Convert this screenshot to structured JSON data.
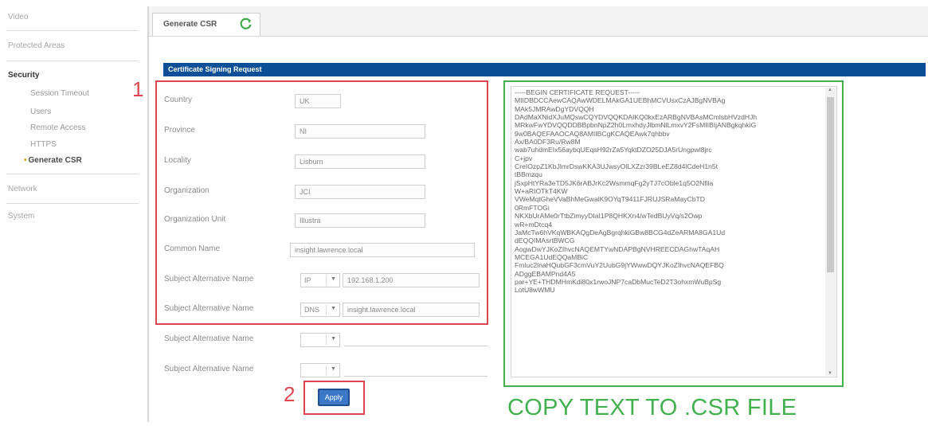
{
  "sidebar": {
    "items": [
      {
        "label": "Video"
      },
      {
        "label": "Protected Areas"
      },
      {
        "label": "Security"
      },
      {
        "label": "Session Timeout"
      },
      {
        "label": "Users"
      },
      {
        "label": "Remote Access"
      },
      {
        "label": "HTTPS"
      },
      {
        "label": "Generate CSR"
      },
      {
        "label": "Network"
      },
      {
        "label": "System"
      }
    ]
  },
  "tab": {
    "label": "Generate CSR",
    "icon": "refresh-icon"
  },
  "section": {
    "title": "Certificate Signing Request"
  },
  "form": {
    "country": {
      "label": "Country",
      "value": "UK"
    },
    "province": {
      "label": "Province",
      "value": "NI"
    },
    "locality": {
      "label": "Locality",
      "value": "Lisburn"
    },
    "organization": {
      "label": "Organization",
      "value": "JCI"
    },
    "org_unit": {
      "label": "Organization Unit",
      "value": "Illustra"
    },
    "common_name": {
      "label": "Common Name",
      "value": "insight.lawrence.local"
    },
    "san1": {
      "label": "Subject Alternative Name",
      "type": "IP",
      "value": "192.168.1.200"
    },
    "san2": {
      "label": "Subject Alternative Name",
      "type": "DNS",
      "value": "insight.lawrence.local"
    },
    "san3": {
      "label": "Subject Alternative Name",
      "type": "",
      "value": ""
    },
    "san4": {
      "label": "Subject Alternative Name",
      "type": "",
      "value": ""
    }
  },
  "apply_button": {
    "label": "Apply"
  },
  "annotations": {
    "step1": "1",
    "step2": "2",
    "copy_note": "COPY TEXT TO .CSR FILE"
  },
  "csr": {
    "text": "-----BEGIN CERTIFICATE REQUEST-----\nMIIDBDCCAewCAQAwWDELMAkGA1UEBhMCVUsxCzAJBgNVBAg\nMAk5JMRAwDgYDVQQH\nDAdMaXNidXJuMQswCQYDVQQKDAIKQ0kxEzARBgNVBAsMCmlsbHVzdHJh\nMRkwFwYDVQQDDBBpbnNpZ2h0LmxhdyJlbmNlLmxvY2FsMIIBIjANBgkqhkiG\n9w0BAQEFAAOCAQ8AMIIBCgKCAQEAwk7qhbbv\nAx/BA0DF3Ru/Rw8M\nwab7uhdmEIx56aybqUEqsH92rZa5YqktDZO25DJA5rUngpwl8jrc\nC+jpv\nCreIOzpZ1KbJlmrDswKKA3UJwsyOlLXZzr39BLeEZ8d4lCdeH1n5t\ntBBmzqu\njSxpHtYRa3eTD5JK6rABJrKc2WsmmqFg2yTJ7cOble1q5O2Nfila\nW+aRIOTkT4KW\nVWeMqtGheVVaBhMeGwalK9OYqT9411FJRUJSRaMayCbTD\n0RmFTOGi\nNKXbUrAMe0rTtbZimyyDIaI1P8QHKXn4/wTedBUyVq/s2Owp\nwR+mDtcq4\nJaMcTw6hVKqWBKAQgDeAgBgrqhkiGBw8BCG4dZeARMA8GA1Ud\ndEQQIMAsrtBWCG\nAogwDwYJKoZIhvcNAQEMTYwNDAPBgNVHREECDAGhwTAqAH\nMCEGA1UdEQQaMBiC\nFmluc2lnaHQubGF3cmVuY2UubG9jYWwwDQYJKoZIhvcNAQEFBQ\nADggEBAMPnd4A5\npar+YE+THDMHmKdi80x1rwoJNP7caDbMucTeD2T3ohxmWuBpSg\nLotU8wWMU"
  }
}
